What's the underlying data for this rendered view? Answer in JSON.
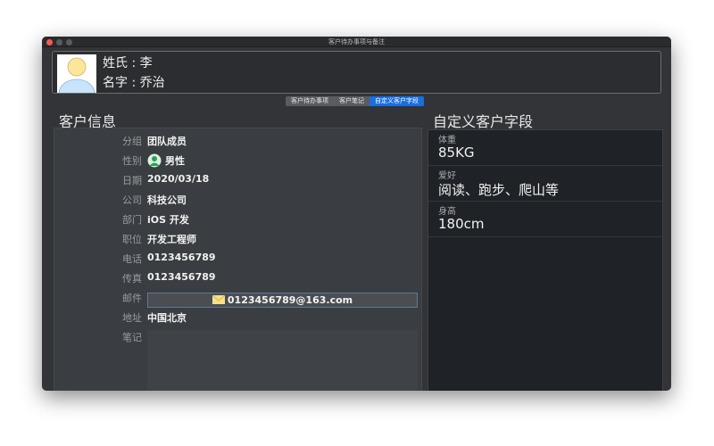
{
  "window": {
    "title": "客户待办事项与备注"
  },
  "header": {
    "surname": "姓氏 : 李",
    "given_name": "名字 : 乔治"
  },
  "tabs": [
    {
      "label": "客户待办事项"
    },
    {
      "label": "客户笔记"
    },
    {
      "label": "自定义客户字段",
      "active": true
    }
  ],
  "customer_info": {
    "title": "客户信息",
    "rows": [
      {
        "label": "分组",
        "value": "团队成员"
      },
      {
        "label": "性别",
        "value": "男性",
        "icon": "person-icon"
      },
      {
        "label": "日期",
        "value": "2020/03/18"
      },
      {
        "label": "公司",
        "value": "科技公司"
      },
      {
        "label": "部门",
        "value": "iOS 开发"
      },
      {
        "label": "职位",
        "value": "开发工程师"
      },
      {
        "label": "电话",
        "value": "0123456789"
      },
      {
        "label": "传真",
        "value": "0123456789"
      }
    ],
    "email": {
      "label": "邮件",
      "value": "0123456789@163.com",
      "icon": "envelope-icon"
    },
    "address": {
      "label": "地址",
      "value": "中国北京"
    },
    "notes": {
      "label": "笔记",
      "value": ""
    }
  },
  "custom_fields": {
    "title": "自定义客户字段",
    "fields": [
      {
        "label": "体重",
        "value": "85KG"
      },
      {
        "label": "爱好",
        "value": "阅读、跑步、爬山等"
      },
      {
        "label": "身高",
        "value": "180cm"
      }
    ]
  },
  "colors": {
    "accent": "#1a6ee0",
    "close": "#fc5753"
  }
}
